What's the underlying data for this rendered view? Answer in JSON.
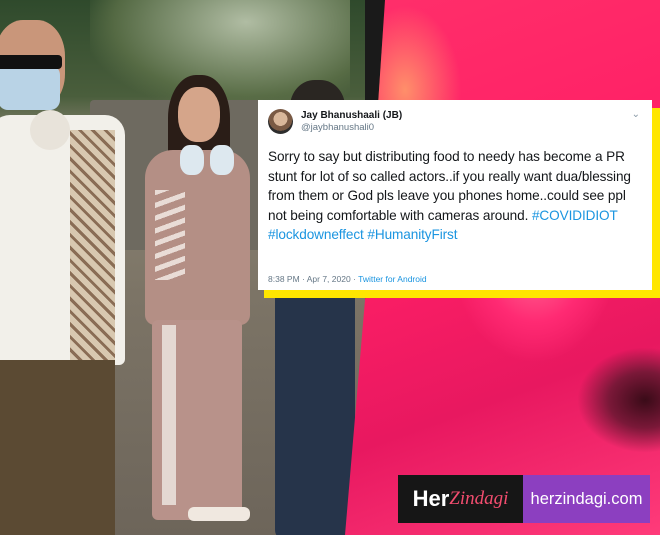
{
  "tweet": {
    "name": "Jay Bhanushaali (JB)",
    "handle": "@jaybhanushali0",
    "body_text": "Sorry to say but distributing food to needy has become a PR stunt for lot of so called actors..if you really want dua/blessing from them or God pls leave you phones home..could see ppl not being comfortable with cameras around. ",
    "hashtags": [
      "#COVIDIDIOT",
      "#lockdowneffect",
      "#HumanityFirst"
    ],
    "timestamp": "8:38 PM · Apr 7, 2020 · ",
    "source": "Twitter for Android",
    "chevron": "⌄"
  },
  "logo": {
    "her": "Her",
    "zindagi": "Zindagi",
    "site": "herzindagi.com"
  },
  "colors": {
    "accent_pink": "#ff1f66",
    "card_shadow": "#ffe600",
    "hashtag_blue": "#1b95e0",
    "brand_purple": "#8c3fc0"
  }
}
